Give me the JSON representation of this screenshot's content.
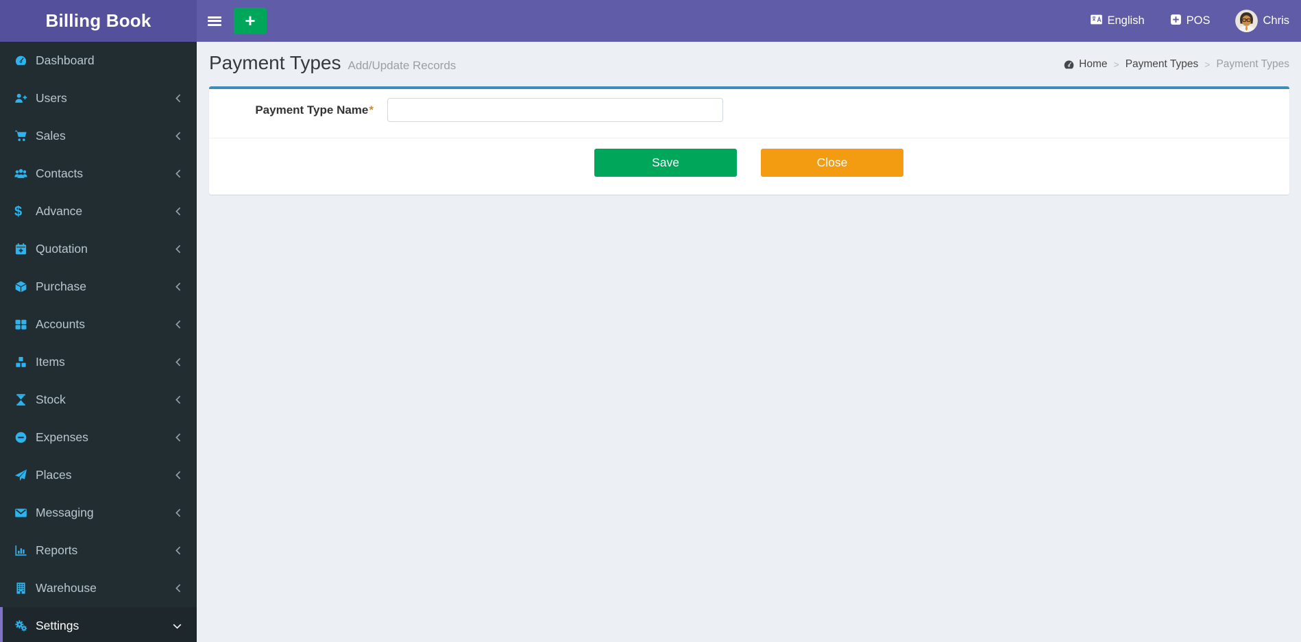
{
  "app": {
    "name": "Billing Book"
  },
  "header": {
    "language_label": "English",
    "pos_label": "POS",
    "user_name": "Chris",
    "add_button": "+"
  },
  "sidebar": {
    "items": [
      {
        "label": "Dashboard",
        "icon": "dashboard-icon",
        "has_submenu": false,
        "active": false
      },
      {
        "label": "Users",
        "icon": "user-plus-icon",
        "has_submenu": true,
        "active": false
      },
      {
        "label": "Sales",
        "icon": "cart-icon",
        "has_submenu": true,
        "active": false
      },
      {
        "label": "Contacts",
        "icon": "users-icon",
        "has_submenu": true,
        "active": false
      },
      {
        "label": "Advance",
        "icon": "dollar-icon",
        "has_submenu": true,
        "active": false
      },
      {
        "label": "Quotation",
        "icon": "calendar-plus-icon",
        "has_submenu": true,
        "active": false
      },
      {
        "label": "Purchase",
        "icon": "cube-icon",
        "has_submenu": true,
        "active": false
      },
      {
        "label": "Accounts",
        "icon": "grid-icon",
        "has_submenu": true,
        "active": false
      },
      {
        "label": "Items",
        "icon": "cubes-icon",
        "has_submenu": true,
        "active": false
      },
      {
        "label": "Stock",
        "icon": "hourglass-icon",
        "has_submenu": true,
        "active": false
      },
      {
        "label": "Expenses",
        "icon": "minus-circle-icon",
        "has_submenu": true,
        "active": false
      },
      {
        "label": "Places",
        "icon": "paper-plane-icon",
        "has_submenu": true,
        "active": false
      },
      {
        "label": "Messaging",
        "icon": "envelope-icon",
        "has_submenu": true,
        "active": false
      },
      {
        "label": "Reports",
        "icon": "bar-chart-icon",
        "has_submenu": true,
        "active": false
      },
      {
        "label": "Warehouse",
        "icon": "building-icon",
        "has_submenu": true,
        "active": false
      },
      {
        "label": "Settings",
        "icon": "gears-icon",
        "has_submenu": true,
        "active": true,
        "expanded": true
      }
    ]
  },
  "page": {
    "title": "Payment Types",
    "subtitle": "Add/Update Records",
    "breadcrumb": {
      "home": "Home",
      "section": "Payment Types",
      "current": "Payment Types"
    }
  },
  "form": {
    "payment_type_name": {
      "label": "Payment Type Name",
      "required_marker": "*",
      "value": "",
      "placeholder": ""
    },
    "save_label": "Save",
    "close_label": "Close"
  },
  "colors": {
    "navbar": "#605ca8",
    "logo_bg": "#54509b",
    "sidebar_bg": "#222d32",
    "sidebar_active_bg": "#1e282c",
    "sidebar_active_border": "#7d72c5",
    "sidebar_icon": "#2db3ee",
    "box_top_border": "#3c8dbc",
    "save_button": "#00a65a",
    "close_button": "#f39c12",
    "content_bg": "#ecf0f5"
  }
}
